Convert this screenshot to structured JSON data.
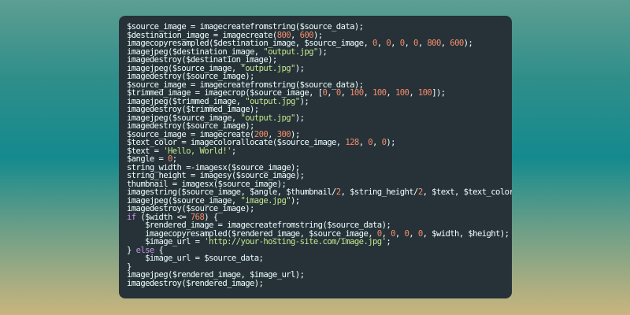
{
  "editor": {
    "background": "#263238",
    "lines": [
      [
        {
          "t": "$source_image = imagecreatefromstring($source_data);",
          "c": "v"
        }
      ],
      [
        {
          "t": "$destination_image = imagecreate(",
          "c": "v"
        },
        {
          "t": "800",
          "c": "n"
        },
        {
          "t": ", ",
          "c": "v"
        },
        {
          "t": "600",
          "c": "n"
        },
        {
          "t": ");",
          "c": "v"
        }
      ],
      [
        {
          "t": "imagecopyresampled($destination_image, $source_image, ",
          "c": "v"
        },
        {
          "t": "0",
          "c": "n"
        },
        {
          "t": ", ",
          "c": "v"
        },
        {
          "t": "0",
          "c": "n"
        },
        {
          "t": ", ",
          "c": "v"
        },
        {
          "t": "0",
          "c": "n"
        },
        {
          "t": ", ",
          "c": "v"
        },
        {
          "t": "0",
          "c": "n"
        },
        {
          "t": ", ",
          "c": "v"
        },
        {
          "t": "800",
          "c": "n"
        },
        {
          "t": ", ",
          "c": "v"
        },
        {
          "t": "600",
          "c": "n"
        },
        {
          "t": ");",
          "c": "v"
        }
      ],
      [
        {
          "t": "imagejpeg($destination_image, ",
          "c": "v"
        },
        {
          "t": "\"output.jpg\"",
          "c": "s"
        },
        {
          "t": ");",
          "c": "v"
        }
      ],
      [
        {
          "t": "imagedestroy($destination_image);",
          "c": "v"
        }
      ],
      [
        {
          "t": "imagejpeg($source_image, ",
          "c": "v"
        },
        {
          "t": "\"output.jpg\"",
          "c": "s"
        },
        {
          "t": ");",
          "c": "v"
        }
      ],
      [
        {
          "t": "imagedestroy($source_image);",
          "c": "v"
        }
      ],
      [
        {
          "t": "$source_image = imagecreatefromstring($source_data);",
          "c": "v"
        }
      ],
      [
        {
          "t": "$trimmed_image = imagecrop($source_image, [",
          "c": "v"
        },
        {
          "t": "0",
          "c": "n"
        },
        {
          "t": ", ",
          "c": "v"
        },
        {
          "t": "0",
          "c": "n"
        },
        {
          "t": ", ",
          "c": "v"
        },
        {
          "t": "100",
          "c": "n"
        },
        {
          "t": ", ",
          "c": "v"
        },
        {
          "t": "100",
          "c": "n"
        },
        {
          "t": ", ",
          "c": "v"
        },
        {
          "t": "100",
          "c": "n"
        },
        {
          "t": ", ",
          "c": "v"
        },
        {
          "t": "100",
          "c": "n"
        },
        {
          "t": "]);",
          "c": "v"
        }
      ],
      [
        {
          "t": "imagejpeg($trimmed_image, ",
          "c": "v"
        },
        {
          "t": "\"output.jpg\"",
          "c": "s"
        },
        {
          "t": ");",
          "c": "v"
        }
      ],
      [
        {
          "t": "imagedestroy($trimmed_image);",
          "c": "v"
        }
      ],
      [
        {
          "t": "imagejpeg($source_image, ",
          "c": "v"
        },
        {
          "t": "\"output.jpg\"",
          "c": "s"
        },
        {
          "t": ");",
          "c": "v"
        }
      ],
      [
        {
          "t": "imagedestroy($source_image);",
          "c": "v"
        }
      ],
      [
        {
          "t": "$source_image = imagecreate(",
          "c": "v"
        },
        {
          "t": "200",
          "c": "n"
        },
        {
          "t": ", ",
          "c": "v"
        },
        {
          "t": "300",
          "c": "n"
        },
        {
          "t": ");",
          "c": "v"
        }
      ],
      [
        {
          "t": "$text_color = imagecolorallocate($source_image, ",
          "c": "v"
        },
        {
          "t": "128",
          "c": "n"
        },
        {
          "t": ", ",
          "c": "v"
        },
        {
          "t": "0",
          "c": "n"
        },
        {
          "t": ", ",
          "c": "v"
        },
        {
          "t": "0",
          "c": "n"
        },
        {
          "t": ");",
          "c": "v"
        }
      ],
      [
        {
          "t": "$text = ",
          "c": "v"
        },
        {
          "t": "'Hello, World!'",
          "c": "s"
        },
        {
          "t": ";",
          "c": "v"
        }
      ],
      [
        {
          "t": "$angle = ",
          "c": "v"
        },
        {
          "t": "0",
          "c": "n"
        },
        {
          "t": ";",
          "c": "v"
        }
      ],
      [
        {
          "t": "string_width =-imagesx($source_image);",
          "c": "v"
        }
      ],
      [
        {
          "t": "string_height = imagesy($source_image);",
          "c": "v"
        }
      ],
      [
        {
          "t": "thumbnail = imagesx($source_image);",
          "c": "v"
        }
      ],
      [
        {
          "t": "imagestring($source_image, $angle, $thumbnail/",
          "c": "v"
        },
        {
          "t": "2",
          "c": "n"
        },
        {
          "t": ", $string_height/",
          "c": "v"
        },
        {
          "t": "2",
          "c": "n"
        },
        {
          "t": ", $text, $text_color);",
          "c": "v"
        }
      ],
      [
        {
          "t": "imagejpeg($source_image, ",
          "c": "v"
        },
        {
          "t": "\"image.jpg\"",
          "c": "s"
        },
        {
          "t": ");",
          "c": "v"
        }
      ],
      [
        {
          "t": "imagedestroy($source_image);",
          "c": "v"
        }
      ],
      [
        {
          "t": "if",
          "c": "k"
        },
        {
          "t": " ($width <= ",
          "c": "v"
        },
        {
          "t": "768",
          "c": "n"
        },
        {
          "t": ") {",
          "c": "v"
        }
      ],
      [
        {
          "t": "    $rendered_image = imagecreatefromstring($source_data);",
          "c": "v"
        }
      ],
      [
        {
          "t": "    imagecopyresampled($rendered_image, $source_image, ",
          "c": "v"
        },
        {
          "t": "0",
          "c": "n"
        },
        {
          "t": ", ",
          "c": "v"
        },
        {
          "t": "0",
          "c": "n"
        },
        {
          "t": ", ",
          "c": "v"
        },
        {
          "t": "0",
          "c": "n"
        },
        {
          "t": ", ",
          "c": "v"
        },
        {
          "t": "0",
          "c": "n"
        },
        {
          "t": ", $width, $height);",
          "c": "v"
        }
      ],
      [
        {
          "t": "    $image_url = ",
          "c": "v"
        },
        {
          "t": "'http://your-hosting-site.com/image.jpg'",
          "c": "s"
        },
        {
          "t": ";",
          "c": "v"
        }
      ],
      [
        {
          "t": "} ",
          "c": "v"
        },
        {
          "t": "else",
          "c": "k"
        },
        {
          "t": " {",
          "c": "v"
        }
      ],
      [
        {
          "t": "    $image_url = $source_data;",
          "c": "v"
        }
      ],
      [
        {
          "t": "}",
          "c": "v"
        }
      ],
      [
        {
          "t": "imagejpeg($rendered_image, $image_url);",
          "c": "v"
        }
      ],
      [
        {
          "t": "imagedestroy($rendered_image);",
          "c": "v"
        }
      ]
    ]
  }
}
